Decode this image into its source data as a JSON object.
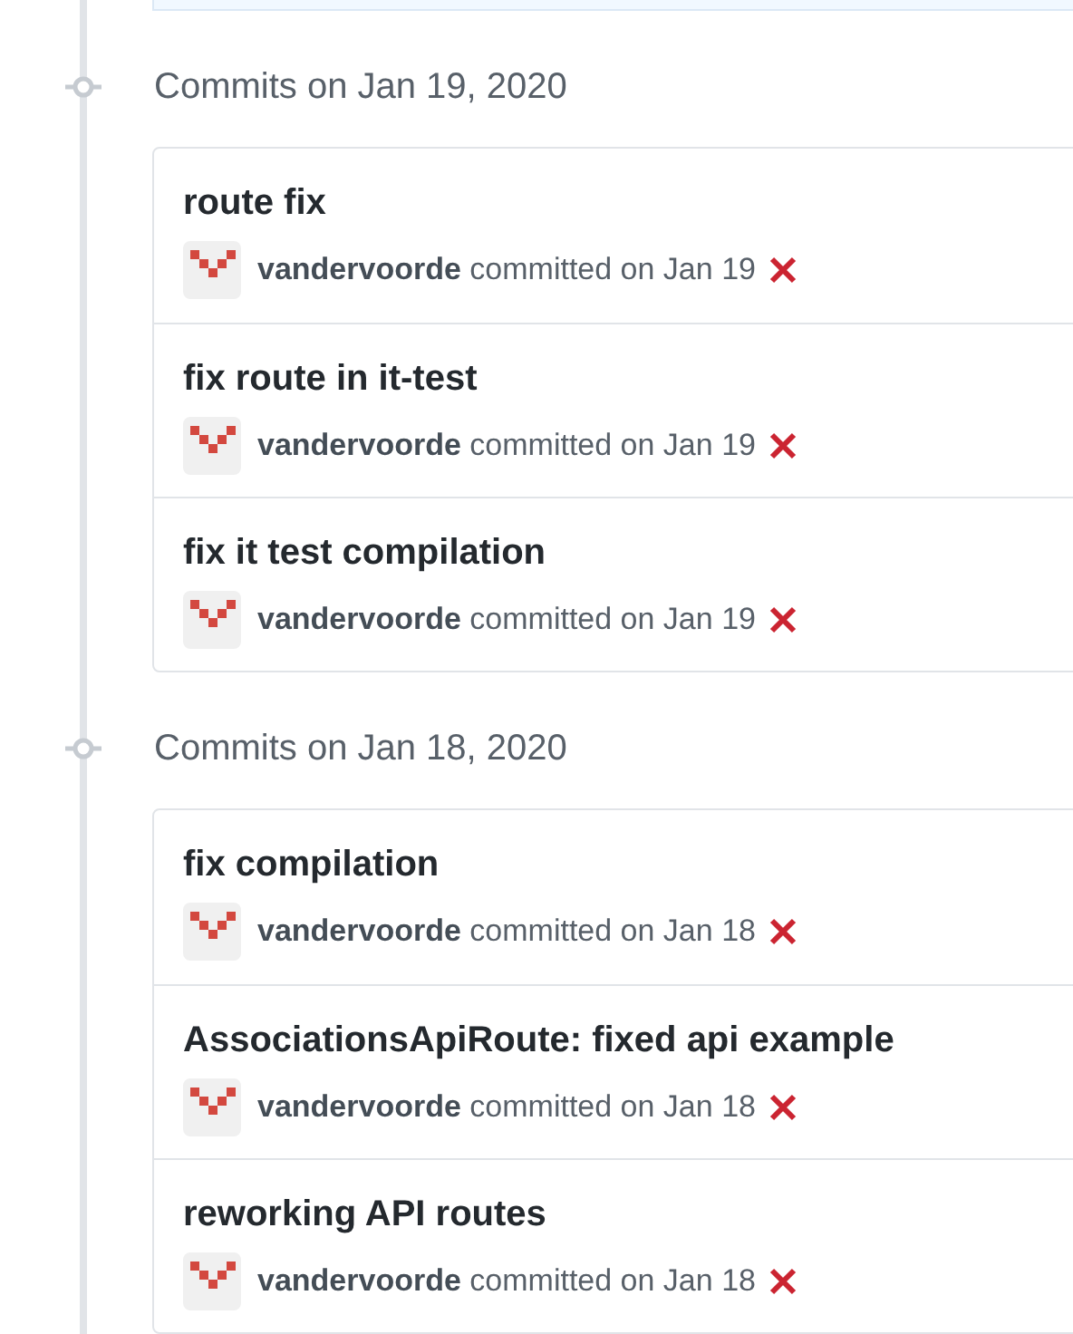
{
  "groups": [
    {
      "date_label": "Commits on Jan 19, 2020",
      "commits": [
        {
          "message": "route fix",
          "author": "vandervoorde",
          "meta": "committed on Jan 19",
          "failed": true
        },
        {
          "message": "fix route in it-test",
          "author": "vandervoorde",
          "meta": "committed on Jan 19",
          "failed": true
        },
        {
          "message": "fix it test compilation",
          "author": "vandervoorde",
          "meta": "committed on Jan 19",
          "failed": true
        }
      ]
    },
    {
      "date_label": "Commits on Jan 18, 2020",
      "commits": [
        {
          "message": "fix compilation",
          "author": "vandervoorde",
          "meta": "committed on Jan 18",
          "failed": true
        },
        {
          "message": "AssociationsApiRoute: fixed api example",
          "author": "vandervoorde",
          "meta": "committed on Jan 18",
          "failed": true
        },
        {
          "message": "reworking API routes",
          "author": "vandervoorde",
          "meta": "committed on Jan 18",
          "failed": true
        }
      ]
    }
  ]
}
